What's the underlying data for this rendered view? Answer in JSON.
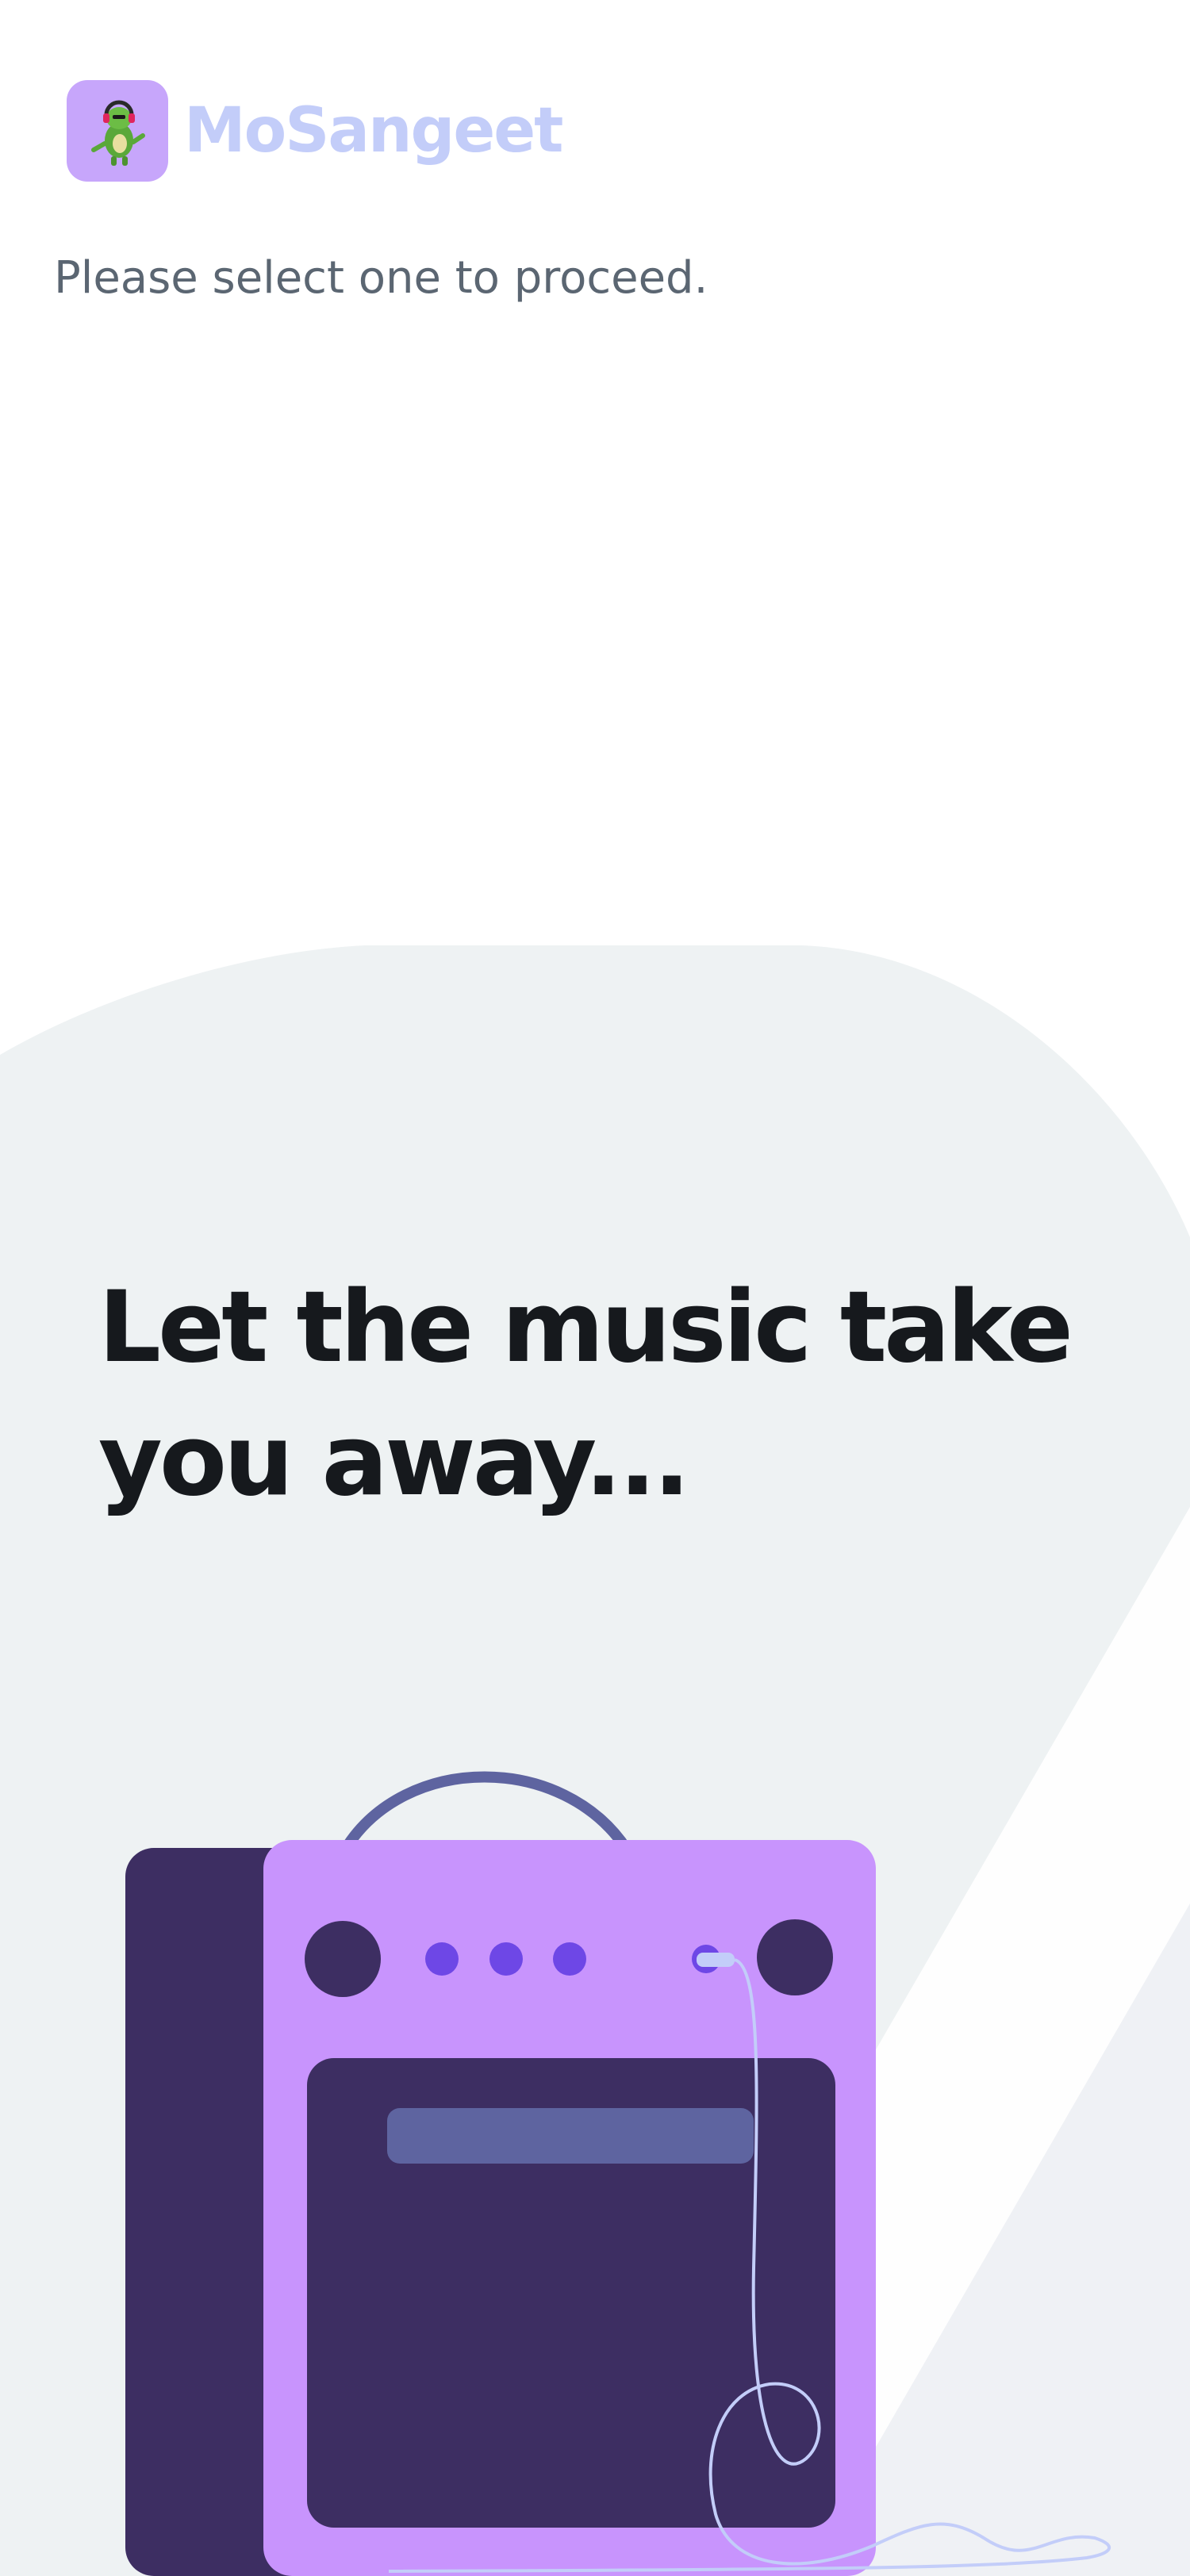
{
  "app": {
    "name": "MoSangeet",
    "logo_icon": "dinosaur-with-headphones-icon"
  },
  "prompt": {
    "instruction": "Please select one to proceed."
  },
  "hero": {
    "headline": "Let the music take you away..."
  },
  "illustration": {
    "icon": "guitar-amplifier-icon"
  },
  "colors": {
    "brand_accent": "#c3cdf9",
    "logo_bg": "#c7a6fb",
    "amp_body": "#c894fd",
    "amp_dark": "#3d2e62",
    "amp_handle": "#5e64a0",
    "knob_purple": "#6e47e6",
    "background_blob": "#eef2f3"
  }
}
